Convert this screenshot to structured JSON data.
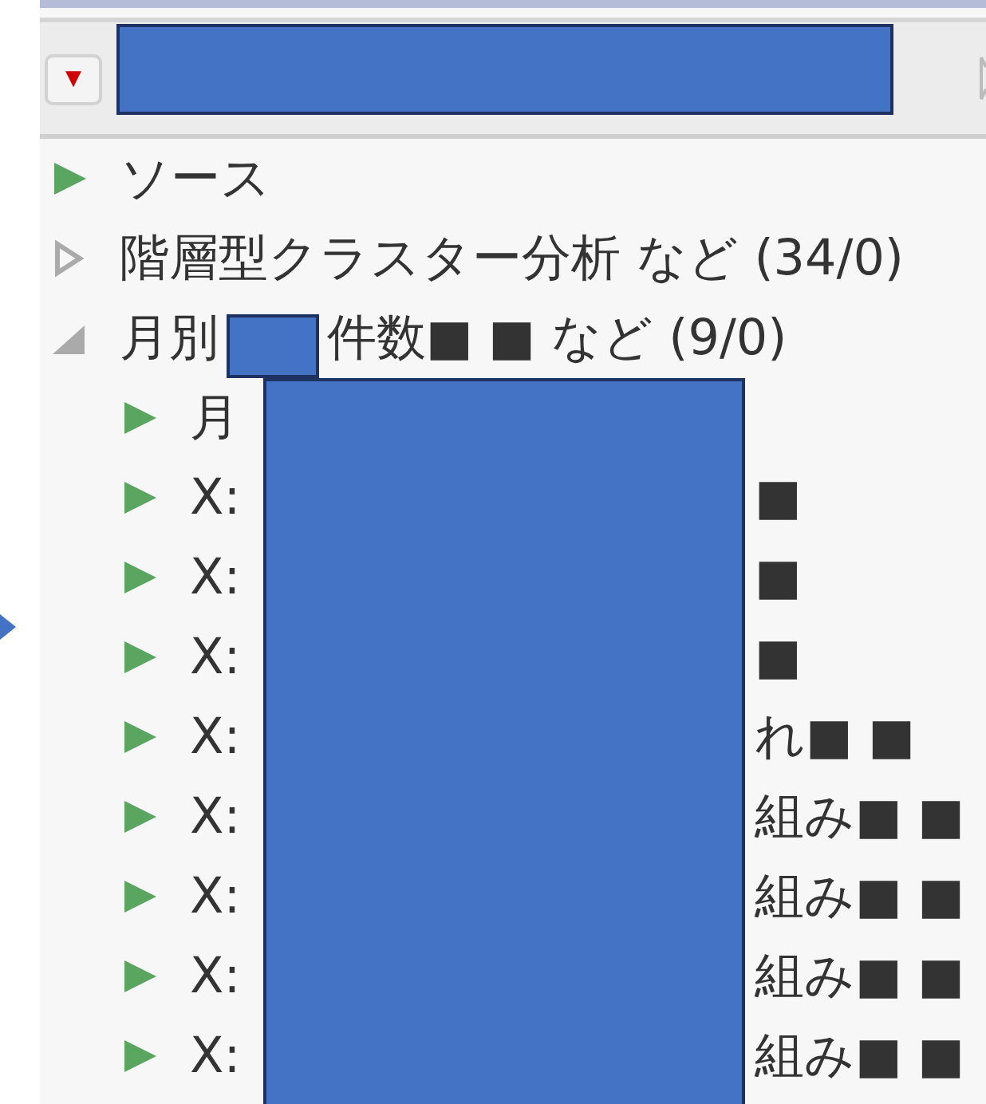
{
  "header": {
    "menu_button": "▼"
  },
  "tree": [
    {
      "label": "ソース",
      "kind": "leaf"
    },
    {
      "label": "階層型クラスター分析 など (34/0)",
      "kind": "group",
      "expanded": false
    },
    {
      "label": "月別",
      "label_end": "件数■ ■ など (9/0)",
      "kind": "group",
      "expanded": true,
      "children": [
        {
          "label": "月",
          "kind": "leaf"
        },
        {
          "label": "X:",
          "label_end": "■",
          "kind": "leaf"
        },
        {
          "label": "X:",
          "label_end": "■",
          "kind": "leaf"
        },
        {
          "label": "X:",
          "label_end": "■",
          "kind": "leaf"
        },
        {
          "label": "X:",
          "label_end": "れ■ ■",
          "kind": "leaf"
        },
        {
          "label": "X:",
          "label_end": "組み■ ■",
          "kind": "leaf"
        },
        {
          "label": "X:",
          "label_end": "組み■ ■",
          "kind": "leaf"
        },
        {
          "label": "X:",
          "label_end": "組み■ ■",
          "kind": "leaf"
        },
        {
          "label": "X:",
          "label_end": "組み■ ■",
          "kind": "leaf"
        }
      ]
    }
  ]
}
